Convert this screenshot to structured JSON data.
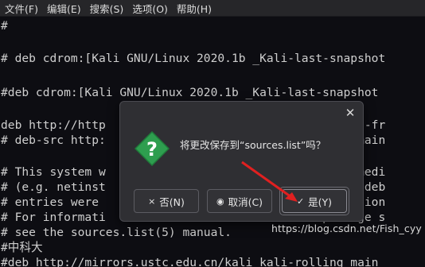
{
  "menubar": {
    "items": [
      "文件(F)",
      "编辑(E)",
      "搜索(S)",
      "选项(O)",
      "帮助(H)"
    ]
  },
  "editor": {
    "lines": [
      "#",
      "",
      "# deb cdrom:[Kali GNU/Linux 2020.1b _Kali-last-snapshot",
      "",
      "#deb cdrom:[Kali GNU/Linux 2020.1b _Kali-last-snapshot",
      "",
      "deb http://http                               in non-fr",
      "# deb-src http:                               ling main",
      "",
      "# This system w                               able medi",
      "# (e.g. netinst                               ning \"deb",
      "# entries were                                tallation",
      "# For informati                               package s",
      "# see the sources.list(5) manual.",
      "#中科大",
      "#deb http://mirrors.ustc.edu.cn/kali kali-rolling main"
    ]
  },
  "dialog": {
    "message": "将更改保存到“sources.list”吗？",
    "close_glyph": "✕",
    "buttons": {
      "no": {
        "icon": "×",
        "label": "否(N)"
      },
      "cancel": {
        "icon": "◉",
        "label": "取消(C)"
      },
      "yes": {
        "icon": "✓",
        "label": "是(Y)"
      }
    },
    "icon": "question-icon"
  },
  "watermark": "https://blog.csdn.net/Fish_cyy",
  "colors": {
    "background": "#0d0d12",
    "dialog": "#2f2f33",
    "question_icon": "#2e9e4f",
    "arrow": "#e02020"
  }
}
